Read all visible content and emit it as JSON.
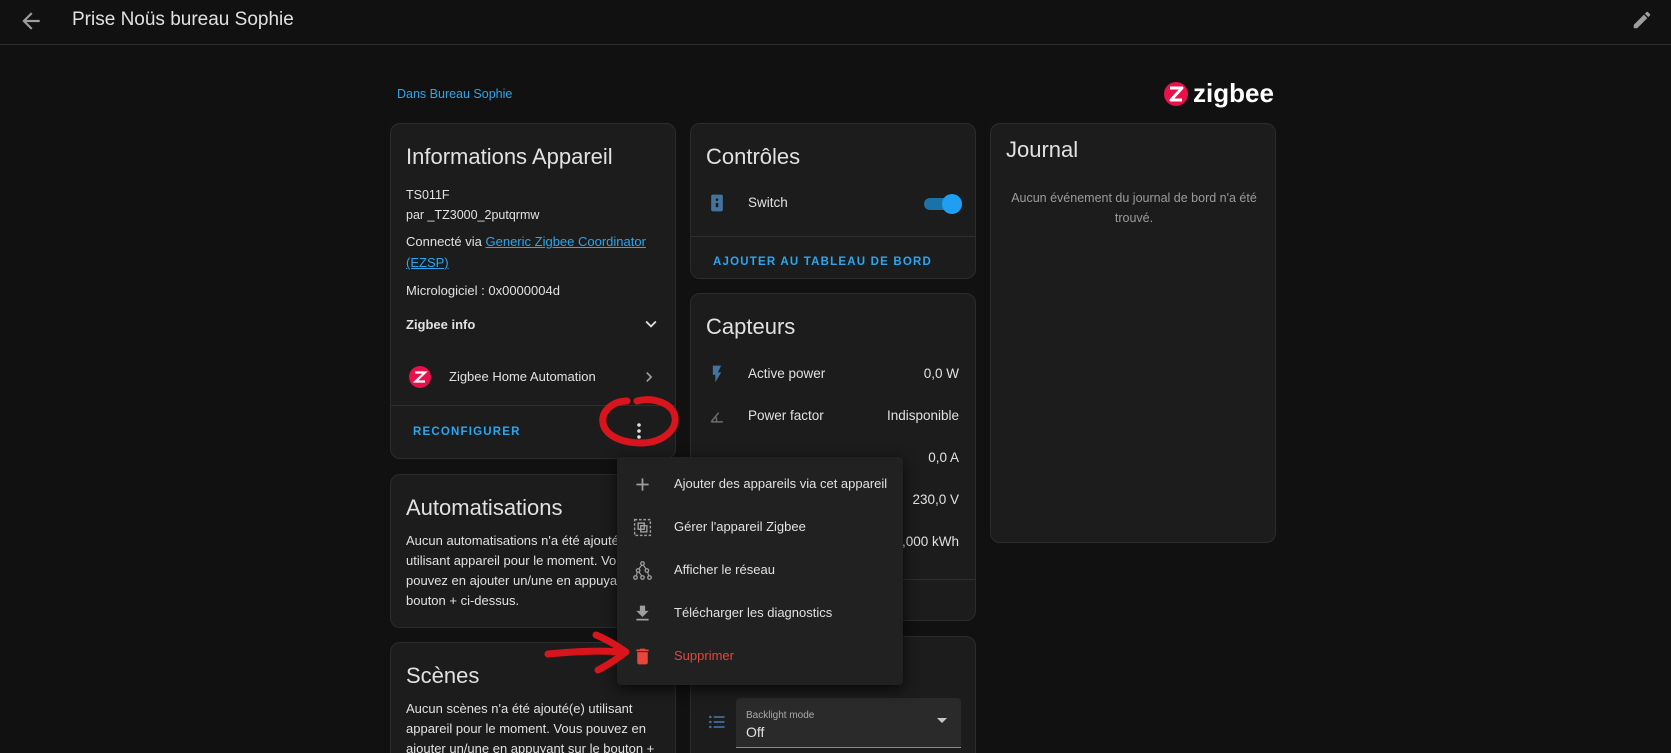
{
  "header": {
    "title": "Prise Noüs bureau Sophie",
    "back_icon": "arrow-left-icon",
    "edit_icon": "pencil-icon"
  },
  "area_link": "Dans Bureau Sophie",
  "brand": {
    "name": "zigbee",
    "color": "#e8114a"
  },
  "colors": {
    "accent": "#2ba6f0",
    "danger": "#e8453c",
    "card_bg": "#1c1c1c",
    "page_bg": "#111111"
  },
  "device_info": {
    "title": "Informations Appareil",
    "model": "TS011F",
    "manufacturer": "par _TZ3000_2putqrmw",
    "connected_prefix": "Connecté via ",
    "connected_link_line1": "Generic Zigbee Coordinator",
    "connected_link_line2": "(EZSP)",
    "firmware": "Micrologiciel : 0x0000004d",
    "zigbee_info_label": "Zigbee info",
    "integration_label": "Zigbee Home Automation",
    "reconfigure_label": "RECONFIGURER"
  },
  "controls": {
    "title": "Contrôles",
    "switch_label": "Switch",
    "switch_on": true,
    "add_dashboard_label": "AJOUTER AU TABLEAU DE BORD"
  },
  "sensors": {
    "title": "Capteurs",
    "rows": [
      {
        "label": "Active power",
        "value": "0,0 W",
        "icon": "flash-icon"
      },
      {
        "label": "Power factor",
        "value": "Indisponible",
        "icon": "angle-acute-icon"
      },
      {
        "label": "",
        "value": "0,0 A",
        "icon": ""
      },
      {
        "label": "",
        "value": "230,0 V",
        "icon": ""
      },
      {
        "label": "",
        "value": "0,000 kWh",
        "icon": ""
      }
    ]
  },
  "journal": {
    "title": "Journal",
    "empty_line1": "Aucun événement du journal de bord n'a été",
    "empty_line2": "trouvé."
  },
  "automations": {
    "title": "Automatisations",
    "lines": [
      "Aucun automatisations n'a été ajouté(",
      "utilisant appareil pour le moment. Vou",
      "pouvez en ajouter un/une en appuyant",
      "bouton + ci-dessus."
    ]
  },
  "scenes": {
    "title": "Scènes",
    "lines": [
      "Aucun scènes n'a été ajouté(e) utilisant",
      "appareil pour le moment. Vous pouvez en",
      "ajouter un/une en appuyant sur le bouton +"
    ]
  },
  "config": {
    "select_label": "Backlight mode",
    "select_value": "Off",
    "list_icon": "format-list-bulleted-icon"
  },
  "menu": {
    "items": [
      {
        "label": "Ajouter des appareils via cet appareil",
        "icon": "plus-icon"
      },
      {
        "label": "Gérer l'appareil Zigbee",
        "icon": "select-group-icon"
      },
      {
        "label": "Afficher le réseau",
        "icon": "network-icon"
      },
      {
        "label": "Télécharger les diagnostics",
        "icon": "download-icon"
      },
      {
        "label": "Supprimer",
        "icon": "trash-icon"
      }
    ]
  }
}
